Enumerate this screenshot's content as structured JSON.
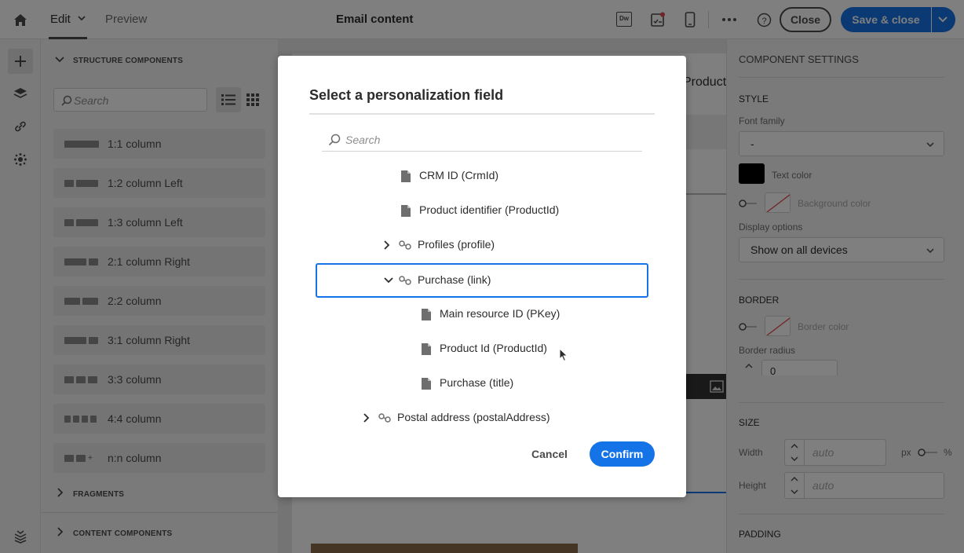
{
  "topbar": {
    "edit_label": "Edit",
    "preview_label": "Preview",
    "title": "Email content",
    "dw_label": "Dw",
    "close_label": "Close",
    "save_close_label": "Save & close"
  },
  "leftpanel": {
    "structure_header": "STRUCTURE COMPONENTS",
    "search_placeholder": "Search",
    "items": [
      {
        "label": "1:1 column"
      },
      {
        "label": "1:2 column Left"
      },
      {
        "label": "1:3 column Left"
      },
      {
        "label": "2:1 column Right"
      },
      {
        "label": "2:2 column"
      },
      {
        "label": "3:1 column Right"
      },
      {
        "label": "3:3 column"
      },
      {
        "label": "4:4 column"
      },
      {
        "label": "n:n column"
      }
    ],
    "fragments_header": "FRAGMENTS",
    "content_header": "CONTENT COMPONENTS"
  },
  "canvas": {
    "products_fragment": "Products"
  },
  "rightpanel": {
    "title": "COMPONENT SETTINGS",
    "style_header": "STYLE",
    "font_family_label": "Font family",
    "font_family_value": "-",
    "text_color_label": "Text color",
    "bg_color_label": "Background color",
    "display_options_label": "Display options",
    "display_options_value": "Show on all devices",
    "border_header": "BORDER",
    "border_color_label": "Border color",
    "border_radius_label": "Border radius",
    "border_radius_value": "0",
    "size_header": "SIZE",
    "width_label": "Width",
    "width_placeholder": "auto",
    "height_label": "Height",
    "height_placeholder": "auto",
    "unit_px": "px",
    "unit_pct": "%",
    "padding_header": "PADDING"
  },
  "dialog": {
    "title": "Select a personalization field",
    "search_placeholder": "Search",
    "tree": [
      {
        "label": "CRM ID (CrmId)",
        "type": "field"
      },
      {
        "label": "Product identifier (ProductId)",
        "type": "field"
      },
      {
        "label": "Profiles (profile)",
        "type": "link",
        "expanded": false
      },
      {
        "label": "Purchase (link)",
        "type": "link",
        "expanded": true,
        "selected": true
      },
      {
        "label": "Main resource ID (PKey)",
        "type": "field"
      },
      {
        "label": "Product Id (ProductId)",
        "type": "field"
      },
      {
        "label": "Purchase (title)",
        "type": "field"
      },
      {
        "label": "Postal address (postalAddress)",
        "type": "link",
        "expanded": false
      }
    ],
    "cancel_label": "Cancel",
    "confirm_label": "Confirm"
  },
  "colors": {
    "accent": "#1473e6",
    "overlay": "rgba(0,0,0,0.5)"
  }
}
